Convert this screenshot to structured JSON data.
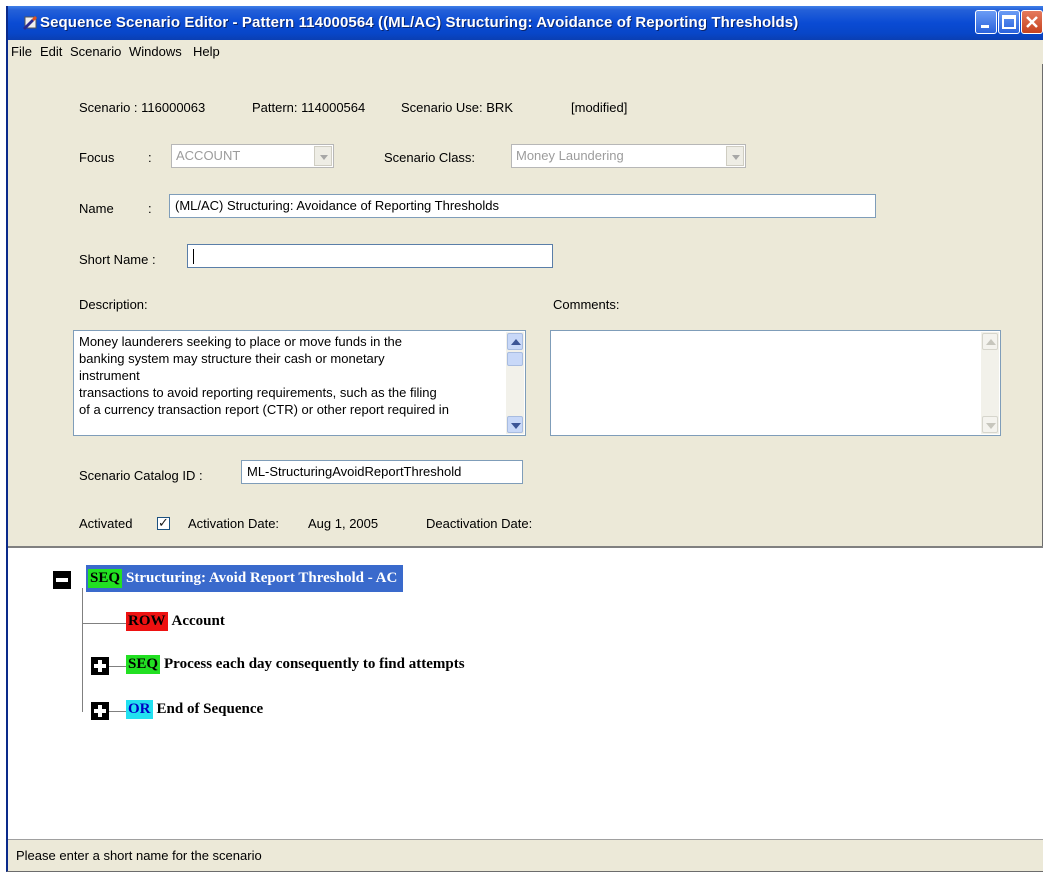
{
  "window": {
    "title": "Sequence Scenario Editor - Pattern 114000564 ((ML/AC) Structuring: Avoidance of Reporting Thresholds)"
  },
  "menu": [
    "File",
    "Edit",
    "Scenario",
    "Windows",
    "Help"
  ],
  "info": {
    "scenario": "Scenario : 116000063",
    "pattern": "Pattern: 114000564",
    "scenario_use": "Scenario Use:  BRK",
    "modified": "[modified]"
  },
  "focus": {
    "label": "Focus",
    "colon": ":",
    "value": "ACCOUNT"
  },
  "scenario_class": {
    "label": "Scenario Class:",
    "value": "Money Laundering"
  },
  "name": {
    "label": "Name",
    "colon": ":",
    "value": "(ML/AC) Structuring: Avoidance of Reporting Thresholds"
  },
  "short_name": {
    "label": "Short Name :",
    "value": ""
  },
  "description": {
    "label": "Description:",
    "lines": [
      "Money launderers seeking to place or move funds in the",
      "banking system may structure their cash or monetary",
      "instrument",
      "transactions to avoid reporting requirements, such as the filing",
      "of a currency transaction report (CTR) or other report required in"
    ]
  },
  "comments": {
    "label": "Comments:",
    "value": ""
  },
  "catalog": {
    "label": "Scenario Catalog ID :",
    "value": "ML-StructuringAvoidReportThreshold"
  },
  "activation": {
    "activated_label": "Activated",
    "activated": true,
    "date_label": "Activation Date:",
    "date_value": "Aug 1, 2005",
    "deactivation_label": "Deactivation Date:"
  },
  "tree": {
    "root": {
      "badge": "SEQ",
      "label": "Structuring: Avoid Report Threshold - AC"
    },
    "children": [
      {
        "badge": "ROW",
        "label": "Account"
      },
      {
        "badge": "SEQ",
        "label": "Process each day consequently to find attempts"
      },
      {
        "badge": "OR",
        "label": "End of Sequence"
      }
    ]
  },
  "status": {
    "text": "Please enter a short name for the scenario"
  },
  "icons": [
    "app-icon",
    "minimize-icon",
    "maximize-icon",
    "close-icon",
    "collapse-icon",
    "expand-icon",
    "scroll-up-icon",
    "scroll-down-icon",
    "checkmark-icon"
  ],
  "colors": {
    "seq_badge": "#22e022",
    "row_badge": "#ee1111",
    "or_badge": "#22e0f0",
    "selection": "#3a6acc",
    "titlebar": "#0a4bd4"
  }
}
